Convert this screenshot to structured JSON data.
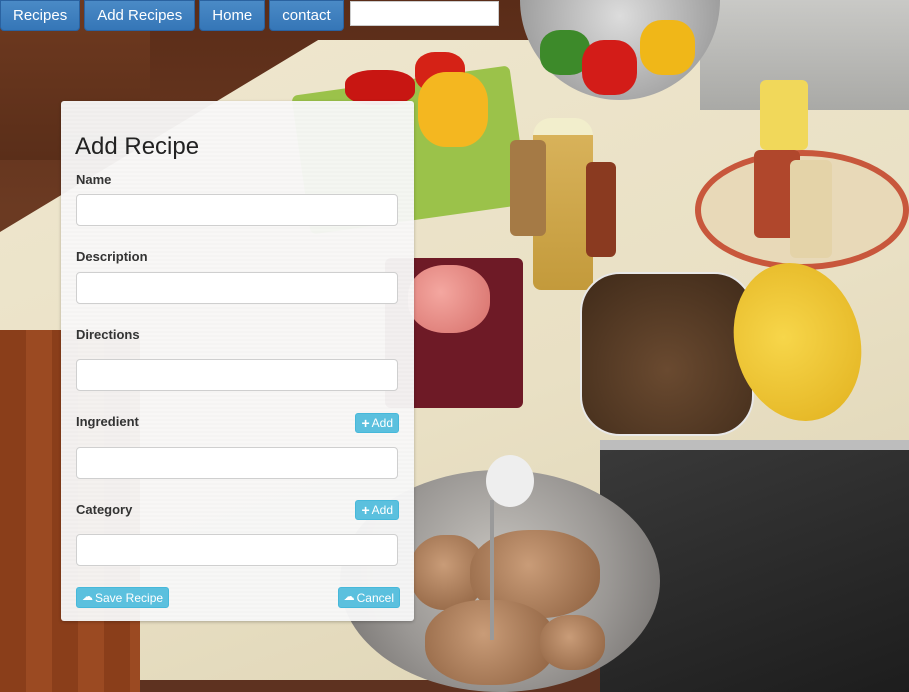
{
  "nav": {
    "items": [
      "Recipes",
      "Add Recipes",
      "Home",
      "contact"
    ],
    "search_value": ""
  },
  "form": {
    "title": "Add Recipe",
    "fields": {
      "name": {
        "label": "Name",
        "value": ""
      },
      "description": {
        "label": "Description",
        "value": ""
      },
      "directions": {
        "label": "Directions",
        "value": ""
      },
      "ingredient": {
        "label": "Ingredient",
        "value": "",
        "add_label": "Add"
      },
      "category": {
        "label": "Category",
        "value": "",
        "add_label": "Add"
      }
    },
    "save_label": "Save Recipe",
    "cancel_label": "Cancel"
  },
  "colors": {
    "nav_blue": "#3576b7",
    "info_button": "#5bc0de"
  },
  "icons": {
    "add": "plus-icon",
    "save": "cloud-upload-icon",
    "cancel": "cloud-icon"
  }
}
